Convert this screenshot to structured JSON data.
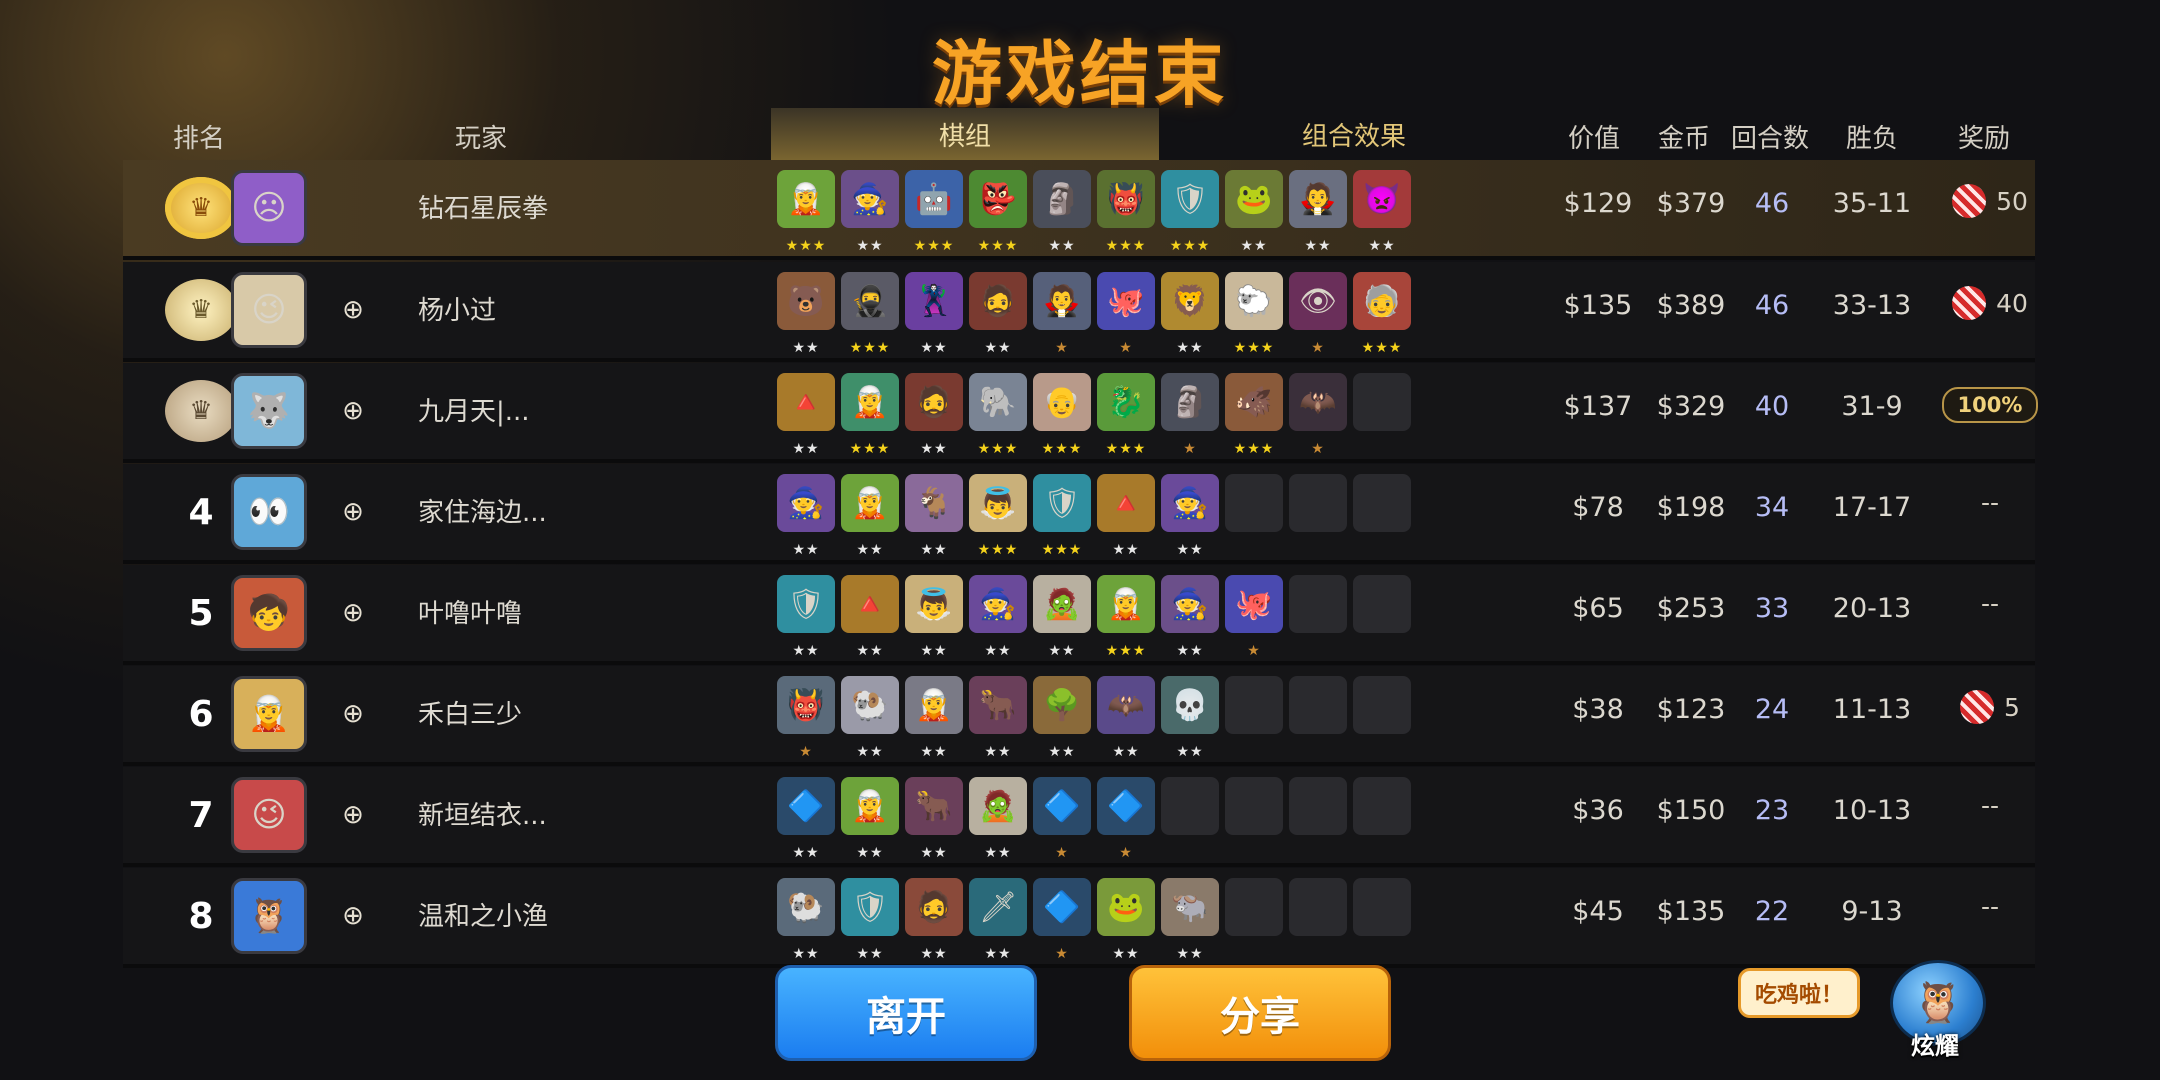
{
  "title": "游戏结束",
  "headers": {
    "rank": "排名",
    "player": "玩家",
    "value": "价值",
    "gold": "金币",
    "rounds": "回合数",
    "winloss": "胜负",
    "reward": "奖励"
  },
  "tabs": {
    "lineup": "棋组",
    "synergy": "组合效果"
  },
  "rows": [
    {
      "rank": "",
      "medal": "gold",
      "avatar_color": "#8f5ec8",
      "avatar_icon": "☹",
      "name": "钻石星辰拳",
      "value": "$129",
      "gold": "$379",
      "rounds": "46",
      "winloss": "35-11",
      "reward_type": "candy",
      "reward": "50",
      "show_add": false,
      "pieces": [
        {
          "c": "#6da33a",
          "i": "🧝",
          "s": 3,
          "t": "gold"
        },
        {
          "c": "#6b4f8a",
          "i": "🧙",
          "s": 2,
          "t": "silver"
        },
        {
          "c": "#3c63a8",
          "i": "🤖",
          "s": 3,
          "t": "gold"
        },
        {
          "c": "#4d8a32",
          "i": "👺",
          "s": 3,
          "t": "gold"
        },
        {
          "c": "#4a4e5a",
          "i": "🗿",
          "s": 2,
          "t": "silver"
        },
        {
          "c": "#5a7030",
          "i": "👹",
          "s": 3,
          "t": "gold"
        },
        {
          "c": "#2f8fa0",
          "i": "🛡",
          "s": 3,
          "t": "gold"
        },
        {
          "c": "#6b7a35",
          "i": "🐸",
          "s": 2,
          "t": "silver"
        },
        {
          "c": "#6a6f80",
          "i": "🧛",
          "s": 2,
          "t": "silver"
        },
        {
          "c": "#a33a3a",
          "i": "👿",
          "s": 2,
          "t": "silver"
        }
      ]
    },
    {
      "rank": "",
      "medal": "silver",
      "avatar_color": "#d8c9a8",
      "avatar_icon": "😉",
      "name": "杨小过",
      "value": "$135",
      "gold": "$389",
      "rounds": "46",
      "winloss": "33-13",
      "reward_type": "candy",
      "reward": "40",
      "show_add": true,
      "pieces": [
        {
          "c": "#8a5a3a",
          "i": "🐻",
          "s": 2,
          "t": "silver"
        },
        {
          "c": "#5a5a66",
          "i": "🥷",
          "s": 3,
          "t": "gold"
        },
        {
          "c": "#6a3fa0",
          "i": "🦹",
          "s": 2,
          "t": "silver"
        },
        {
          "c": "#7a3a30",
          "i": "🧔",
          "s": 2,
          "t": "silver"
        },
        {
          "c": "#56607a",
          "i": "🧛",
          "s": 1,
          "t": "bronze"
        },
        {
          "c": "#4a4ab0",
          "i": "🐙",
          "s": 1,
          "t": "bronze"
        },
        {
          "c": "#b08a30",
          "i": "🦁",
          "s": 2,
          "t": "silver"
        },
        {
          "c": "#c9b89a",
          "i": "🐑",
          "s": 3,
          "t": "gold"
        },
        {
          "c": "#6a2f5a",
          "i": "👁",
          "s": 1,
          "t": "bronze"
        },
        {
          "c": "#a8453a",
          "i": "🧓",
          "s": 3,
          "t": "gold"
        }
      ]
    },
    {
      "rank": "",
      "medal": "bronze",
      "avatar_color": "#7fb7d8",
      "avatar_icon": "🐺",
      "name": "九月天|...",
      "value": "$137",
      "gold": "$329",
      "rounds": "40",
      "winloss": "31-9",
      "reward_type": "percent",
      "reward": "100%",
      "show_add": true,
      "pieces": [
        {
          "c": "#a87a2a",
          "i": "🔺",
          "s": 2,
          "t": "silver"
        },
        {
          "c": "#3f8f6a",
          "i": "🧝",
          "s": 3,
          "t": "gold"
        },
        {
          "c": "#7a3a30",
          "i": "🧔",
          "s": 2,
          "t": "silver"
        },
        {
          "c": "#7a8494",
          "i": "🐘",
          "s": 3,
          "t": "gold"
        },
        {
          "c": "#b89a8a",
          "i": "👴",
          "s": 3,
          "t": "gold"
        },
        {
          "c": "#5a9a3a",
          "i": "🐉",
          "s": 3,
          "t": "gold"
        },
        {
          "c": "#4a4e5a",
          "i": "🗿",
          "s": 1,
          "t": "bronze"
        },
        {
          "c": "#8a5a3a",
          "i": "🐗",
          "s": 3,
          "t": "gold"
        },
        {
          "c": "#3a2f3a",
          "i": "🦇",
          "s": 1,
          "t": "bronze"
        },
        {
          "c": "",
          "i": "",
          "s": 0,
          "t": ""
        }
      ]
    },
    {
      "rank": "4",
      "medal": "",
      "avatar_color": "#5fa8d8",
      "avatar_icon": "👀",
      "name": "家住海边...",
      "value": "$78",
      "gold": "$198",
      "rounds": "34",
      "winloss": "17-17",
      "reward_type": "none",
      "reward": "--",
      "show_add": true,
      "pieces": [
        {
          "c": "#6a4a9a",
          "i": "🧙",
          "s": 2,
          "t": "silver"
        },
        {
          "c": "#6da33a",
          "i": "🧝",
          "s": 2,
          "t": "silver"
        },
        {
          "c": "#8a6a9a",
          "i": "🐐",
          "s": 2,
          "t": "silver"
        },
        {
          "c": "#c9b07a",
          "i": "👼",
          "s": 3,
          "t": "gold"
        },
        {
          "c": "#2f8fa0",
          "i": "🛡",
          "s": 3,
          "t": "gold"
        },
        {
          "c": "#a87a2a",
          "i": "🔺",
          "s": 2,
          "t": "silver"
        },
        {
          "c": "#6a4a9a",
          "i": "🧙",
          "s": 2,
          "t": "silver"
        },
        {
          "c": "",
          "i": "",
          "s": 0,
          "t": ""
        },
        {
          "c": "",
          "i": "",
          "s": 0,
          "t": ""
        },
        {
          "c": "",
          "i": "",
          "s": 0,
          "t": ""
        }
      ]
    },
    {
      "rank": "5",
      "medal": "",
      "avatar_color": "#c85a3a",
      "avatar_icon": "🧒",
      "name": "叶噜叶噜",
      "value": "$65",
      "gold": "$253",
      "rounds": "33",
      "winloss": "20-13",
      "reward_type": "none",
      "reward": "--",
      "show_add": true,
      "pieces": [
        {
          "c": "#2f8fa0",
          "i": "🛡",
          "s": 2,
          "t": "silver"
        },
        {
          "c": "#a87a2a",
          "i": "🔺",
          "s": 2,
          "t": "silver"
        },
        {
          "c": "#c9b07a",
          "i": "👼",
          "s": 2,
          "t": "silver"
        },
        {
          "c": "#6a4a9a",
          "i": "🧙",
          "s": 2,
          "t": "silver"
        },
        {
          "c": "#b8b0a0",
          "i": "🧟",
          "s": 2,
          "t": "silver"
        },
        {
          "c": "#6da33a",
          "i": "🧝",
          "s": 3,
          "t": "gold"
        },
        {
          "c": "#6b4f8a",
          "i": "🧙",
          "s": 2,
          "t": "silver"
        },
        {
          "c": "#4a4ab0",
          "i": "🐙",
          "s": 1,
          "t": "bronze"
        },
        {
          "c": "",
          "i": "",
          "s": 0,
          "t": ""
        },
        {
          "c": "",
          "i": "",
          "s": 0,
          "t": ""
        }
      ]
    },
    {
      "rank": "6",
      "medal": "",
      "avatar_color": "#d8b05a",
      "avatar_icon": "🧝",
      "name": "禾白三少",
      "value": "$38",
      "gold": "$123",
      "rounds": "24",
      "winloss": "11-13",
      "reward_type": "candy",
      "reward": "5",
      "show_add": true,
      "pieces": [
        {
          "c": "#5a6a7a",
          "i": "👹",
          "s": 1,
          "t": "bronze"
        },
        {
          "c": "#9a9aa8",
          "i": "🐏",
          "s": 2,
          "t": "silver"
        },
        {
          "c": "#7a7a86",
          "i": "🧝",
          "s": 2,
          "t": "silver"
        },
        {
          "c": "#6a3f5a",
          "i": "🐂",
          "s": 2,
          "t": "silver"
        },
        {
          "c": "#8a6a3a",
          "i": "🌳",
          "s": 2,
          "t": "silver"
        },
        {
          "c": "#5a4a8a",
          "i": "🦇",
          "s": 2,
          "t": "silver"
        },
        {
          "c": "#4a6a6a",
          "i": "💀",
          "s": 2,
          "t": "silver"
        },
        {
          "c": "",
          "i": "",
          "s": 0,
          "t": ""
        },
        {
          "c": "",
          "i": "",
          "s": 0,
          "t": ""
        },
        {
          "c": "",
          "i": "",
          "s": 0,
          "t": ""
        }
      ]
    },
    {
      "rank": "7",
      "medal": "",
      "avatar_color": "#c84a4a",
      "avatar_icon": "😉",
      "name": "新垣结衣...",
      "value": "$36",
      "gold": "$150",
      "rounds": "23",
      "winloss": "10-13",
      "reward_type": "none",
      "reward": "--",
      "show_add": true,
      "pieces": [
        {
          "c": "#2a4a6a",
          "i": "🔷",
          "s": 2,
          "t": "silver"
        },
        {
          "c": "#6da33a",
          "i": "🧝",
          "s": 2,
          "t": "silver"
        },
        {
          "c": "#6a3f5a",
          "i": "🐂",
          "s": 2,
          "t": "silver"
        },
        {
          "c": "#b8b0a0",
          "i": "🧟",
          "s": 2,
          "t": "silver"
        },
        {
          "c": "#2a4a6a",
          "i": "🔷",
          "s": 1,
          "t": "bronze"
        },
        {
          "c": "#2a4a6a",
          "i": "🔷",
          "s": 1,
          "t": "bronze"
        },
        {
          "c": "",
          "i": "",
          "s": 0,
          "t": ""
        },
        {
          "c": "",
          "i": "",
          "s": 0,
          "t": ""
        },
        {
          "c": "",
          "i": "",
          "s": 0,
          "t": ""
        },
        {
          "c": "",
          "i": "",
          "s": 0,
          "t": ""
        }
      ]
    },
    {
      "rank": "8",
      "medal": "",
      "avatar_color": "#3a7ad8",
      "avatar_icon": "🦉",
      "name": "温和之小渔",
      "value": "$45",
      "gold": "$135",
      "rounds": "22",
      "winloss": "9-13",
      "reward_type": "none",
      "reward": "--",
      "show_add": true,
      "pieces": [
        {
          "c": "#5a6a7a",
          "i": "🐏",
          "s": 2,
          "t": "silver"
        },
        {
          "c": "#2f8fa0",
          "i": "🛡",
          "s": 2,
          "t": "silver"
        },
        {
          "c": "#8a4a3a",
          "i": "🧔",
          "s": 2,
          "t": "silver"
        },
        {
          "c": "#2a6a7a",
          "i": "🗡",
          "s": 2,
          "t": "silver"
        },
        {
          "c": "#2a4a6a",
          "i": "🔷",
          "s": 1,
          "t": "bronze"
        },
        {
          "c": "#7a9a3a",
          "i": "🐸",
          "s": 2,
          "t": "silver"
        },
        {
          "c": "#8a7a6a",
          "i": "🐃",
          "s": 2,
          "t": "silver"
        },
        {
          "c": "",
          "i": "",
          "s": 0,
          "t": ""
        },
        {
          "c": "",
          "i": "",
          "s": 0,
          "t": ""
        },
        {
          "c": "",
          "i": "",
          "s": 0,
          "t": ""
        }
      ]
    }
  ],
  "buttons": {
    "leave": "离开",
    "share": "分享"
  },
  "bubble": "吃鸡啦！",
  "mascot_label": "炫耀"
}
